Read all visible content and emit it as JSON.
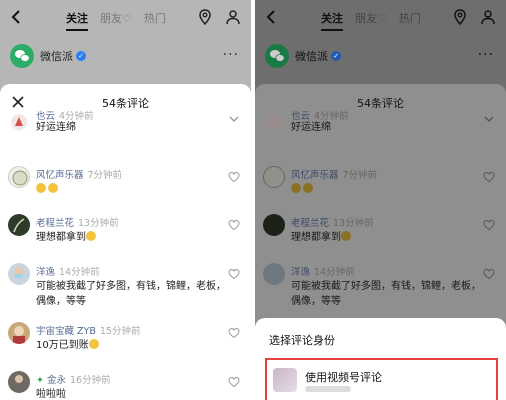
{
  "topbar": {
    "tabs": [
      {
        "label": "关注"
      },
      {
        "label": "朋友♡"
      },
      {
        "label": "热门"
      }
    ]
  },
  "account": {
    "name": "微信派",
    "more": "···"
  },
  "sheet": {
    "title": "54条评论"
  },
  "comments": [
    {
      "author": "也云",
      "time": "4分钟前",
      "text": "好运连绵"
    },
    {
      "author": "风忆声乐器",
      "time": "7分钟前",
      "text": ""
    },
    {
      "author": "老程兰花",
      "time": "13分钟前",
      "text": "理想都拿到"
    },
    {
      "author": "洋逸",
      "time": "14分钟前",
      "text": "可能被我截了好多图，有钱，锦鲤，老板，偶像，等等"
    },
    {
      "author": "宇宙宝藏 ZYB",
      "time": "15分钟前",
      "text": "10万已到账"
    },
    {
      "author": "金永",
      "time": "16分钟前",
      "text": "啦啦啦"
    }
  ],
  "identity_sheet": {
    "title": "选择评论身份",
    "option_label": "使用视频号评论"
  },
  "colors": {
    "accent_red": "#e8413b",
    "link_blue": "#576b95",
    "wechat_green": "#2aae67"
  }
}
